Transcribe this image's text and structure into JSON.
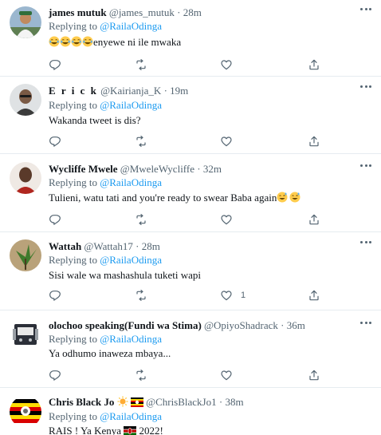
{
  "tweets": [
    {
      "name": "james mutuk",
      "handle": "@james_mutuk",
      "time": "28m",
      "reply_prefix": "Replying to",
      "mention": "@RailaOdinga",
      "emojis_before": 4,
      "text": "enyewe ni ile mwaka",
      "text_after": "",
      "emojis_after": 0,
      "like_count": ""
    },
    {
      "name": "E r i c k",
      "handle": "@Kairianja_K",
      "time": "19m",
      "reply_prefix": "Replying to",
      "mention": "@RailaOdinga",
      "emojis_before": 0,
      "text": "Wakanda tweet is dis?",
      "text_after": "",
      "emojis_after": 0,
      "like_count": ""
    },
    {
      "name": "Wycliffe Mwele",
      "handle": "@MweleWycliffe",
      "time": "32m",
      "reply_prefix": "Replying to",
      "mention": "@RailaOdinga",
      "emojis_before": 0,
      "text": "Tulieni, watu tati and you're ready to swear Baba again",
      "text_after": "",
      "emojis_after": 2,
      "like_count": ""
    },
    {
      "name": "Wattah",
      "handle": "@Wattah17",
      "time": "28m",
      "reply_prefix": "Replying to",
      "mention": "@RailaOdinga",
      "emojis_before": 0,
      "text": "Sisi wale wa mashashula tuketi wapi",
      "text_after": "",
      "emojis_after": 0,
      "like_count": "1"
    },
    {
      "name": "olochoo speaking(Fundi wa Stima)",
      "handle": "@OpiyoShadrack",
      "time": "36m",
      "reply_prefix": "Replying to",
      "mention": "@RailaOdinga",
      "emojis_before": 0,
      "text": "Ya odhumo inaweza mbaya...",
      "text_after": "",
      "emojis_after": 0,
      "like_count": ""
    },
    {
      "name": "Chris Black Jo",
      "handle": "@ChrisBlackJo1",
      "time": "38m",
      "reply_prefix": "Replying to",
      "mention": "@RailaOdinga",
      "emojis_before": 0,
      "text": "RAIS ! Ya Kenya",
      "text_after": "2022!",
      "emojis_after": 0,
      "like_count": ""
    }
  ],
  "separator": "·",
  "icons": {
    "reply": "reply-icon",
    "retweet": "retweet-icon",
    "like": "heart-icon",
    "share": "share-icon",
    "more": "more-icon"
  },
  "colors": {
    "accent": "#1d9bf0",
    "muted": "#536471",
    "border": "#e6ecf0",
    "text": "#0f1419"
  }
}
